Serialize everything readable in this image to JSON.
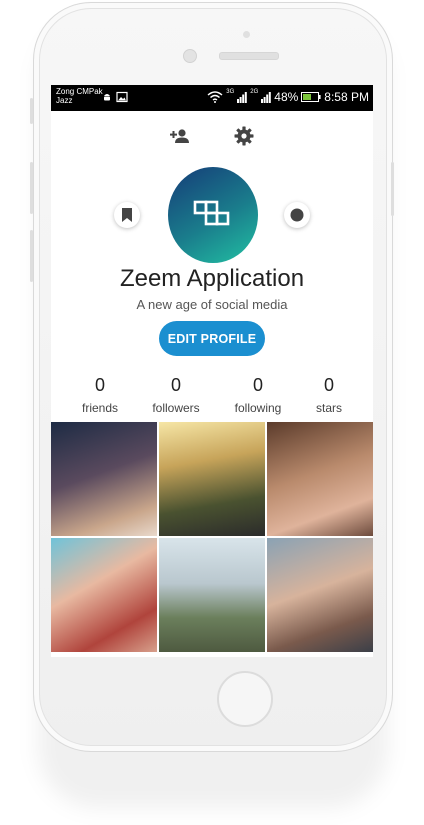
{
  "status_bar": {
    "carrier_line1": "Zong CMPak",
    "carrier_line2": "Jazz",
    "signal_tag1": "3G",
    "signal_tag2": "2G",
    "battery": "48%",
    "time": "8:58 PM"
  },
  "profile": {
    "name": "Zeem Application",
    "tagline": "A new age of social media",
    "edit_button": "EDIT PROFILE"
  },
  "stats": [
    {
      "value": "0",
      "label": "friends"
    },
    {
      "value": "0",
      "label": "followers"
    },
    {
      "value": "0",
      "label": "following"
    },
    {
      "value": "0",
      "label": "stars"
    }
  ],
  "icons": {
    "add_friend": "person-add-icon",
    "settings": "gear-icon",
    "bookmark": "bookmark-icon",
    "record": "dot-icon",
    "logo": "grid-logo-icon"
  },
  "colors": {
    "accent": "#1b8fd0",
    "avatar_start": "#153c78",
    "avatar_end": "#22c1a3"
  },
  "photos": [
    {
      "name": "photo-1",
      "bg": "linear-gradient(160deg,#1d2b44 0%,#5a4a5e 45%,#c9a68b 80%,#e9d9cc 100%)"
    },
    {
      "name": "photo-2",
      "bg": "linear-gradient(170deg,#f6e6a6 0%,#c7a45a 35%,#4a5230 70%,#2b2b2b 100%)"
    },
    {
      "name": "photo-3",
      "bg": "linear-gradient(160deg,#5b3b2b 0%,#b98a6c 45%,#dfb39b 75%,#6d4b3d 100%)"
    },
    {
      "name": "photo-4",
      "bg": "linear-gradient(150deg,#6fc3d9 0%,#e8b9a1 40%,#b0443c 75%,#d7a08c 100%)"
    },
    {
      "name": "photo-5",
      "bg": "linear-gradient(180deg,#d8e4ea 0%,#b9c7ce 40%,#6b7f5c 70%,#4e5a40 100%)"
    },
    {
      "name": "photo-6",
      "bg": "linear-gradient(160deg,#8aa2b4 0%,#d7b39c 45%,#7a5a4c 75%,#3b3f48 100%)"
    }
  ]
}
